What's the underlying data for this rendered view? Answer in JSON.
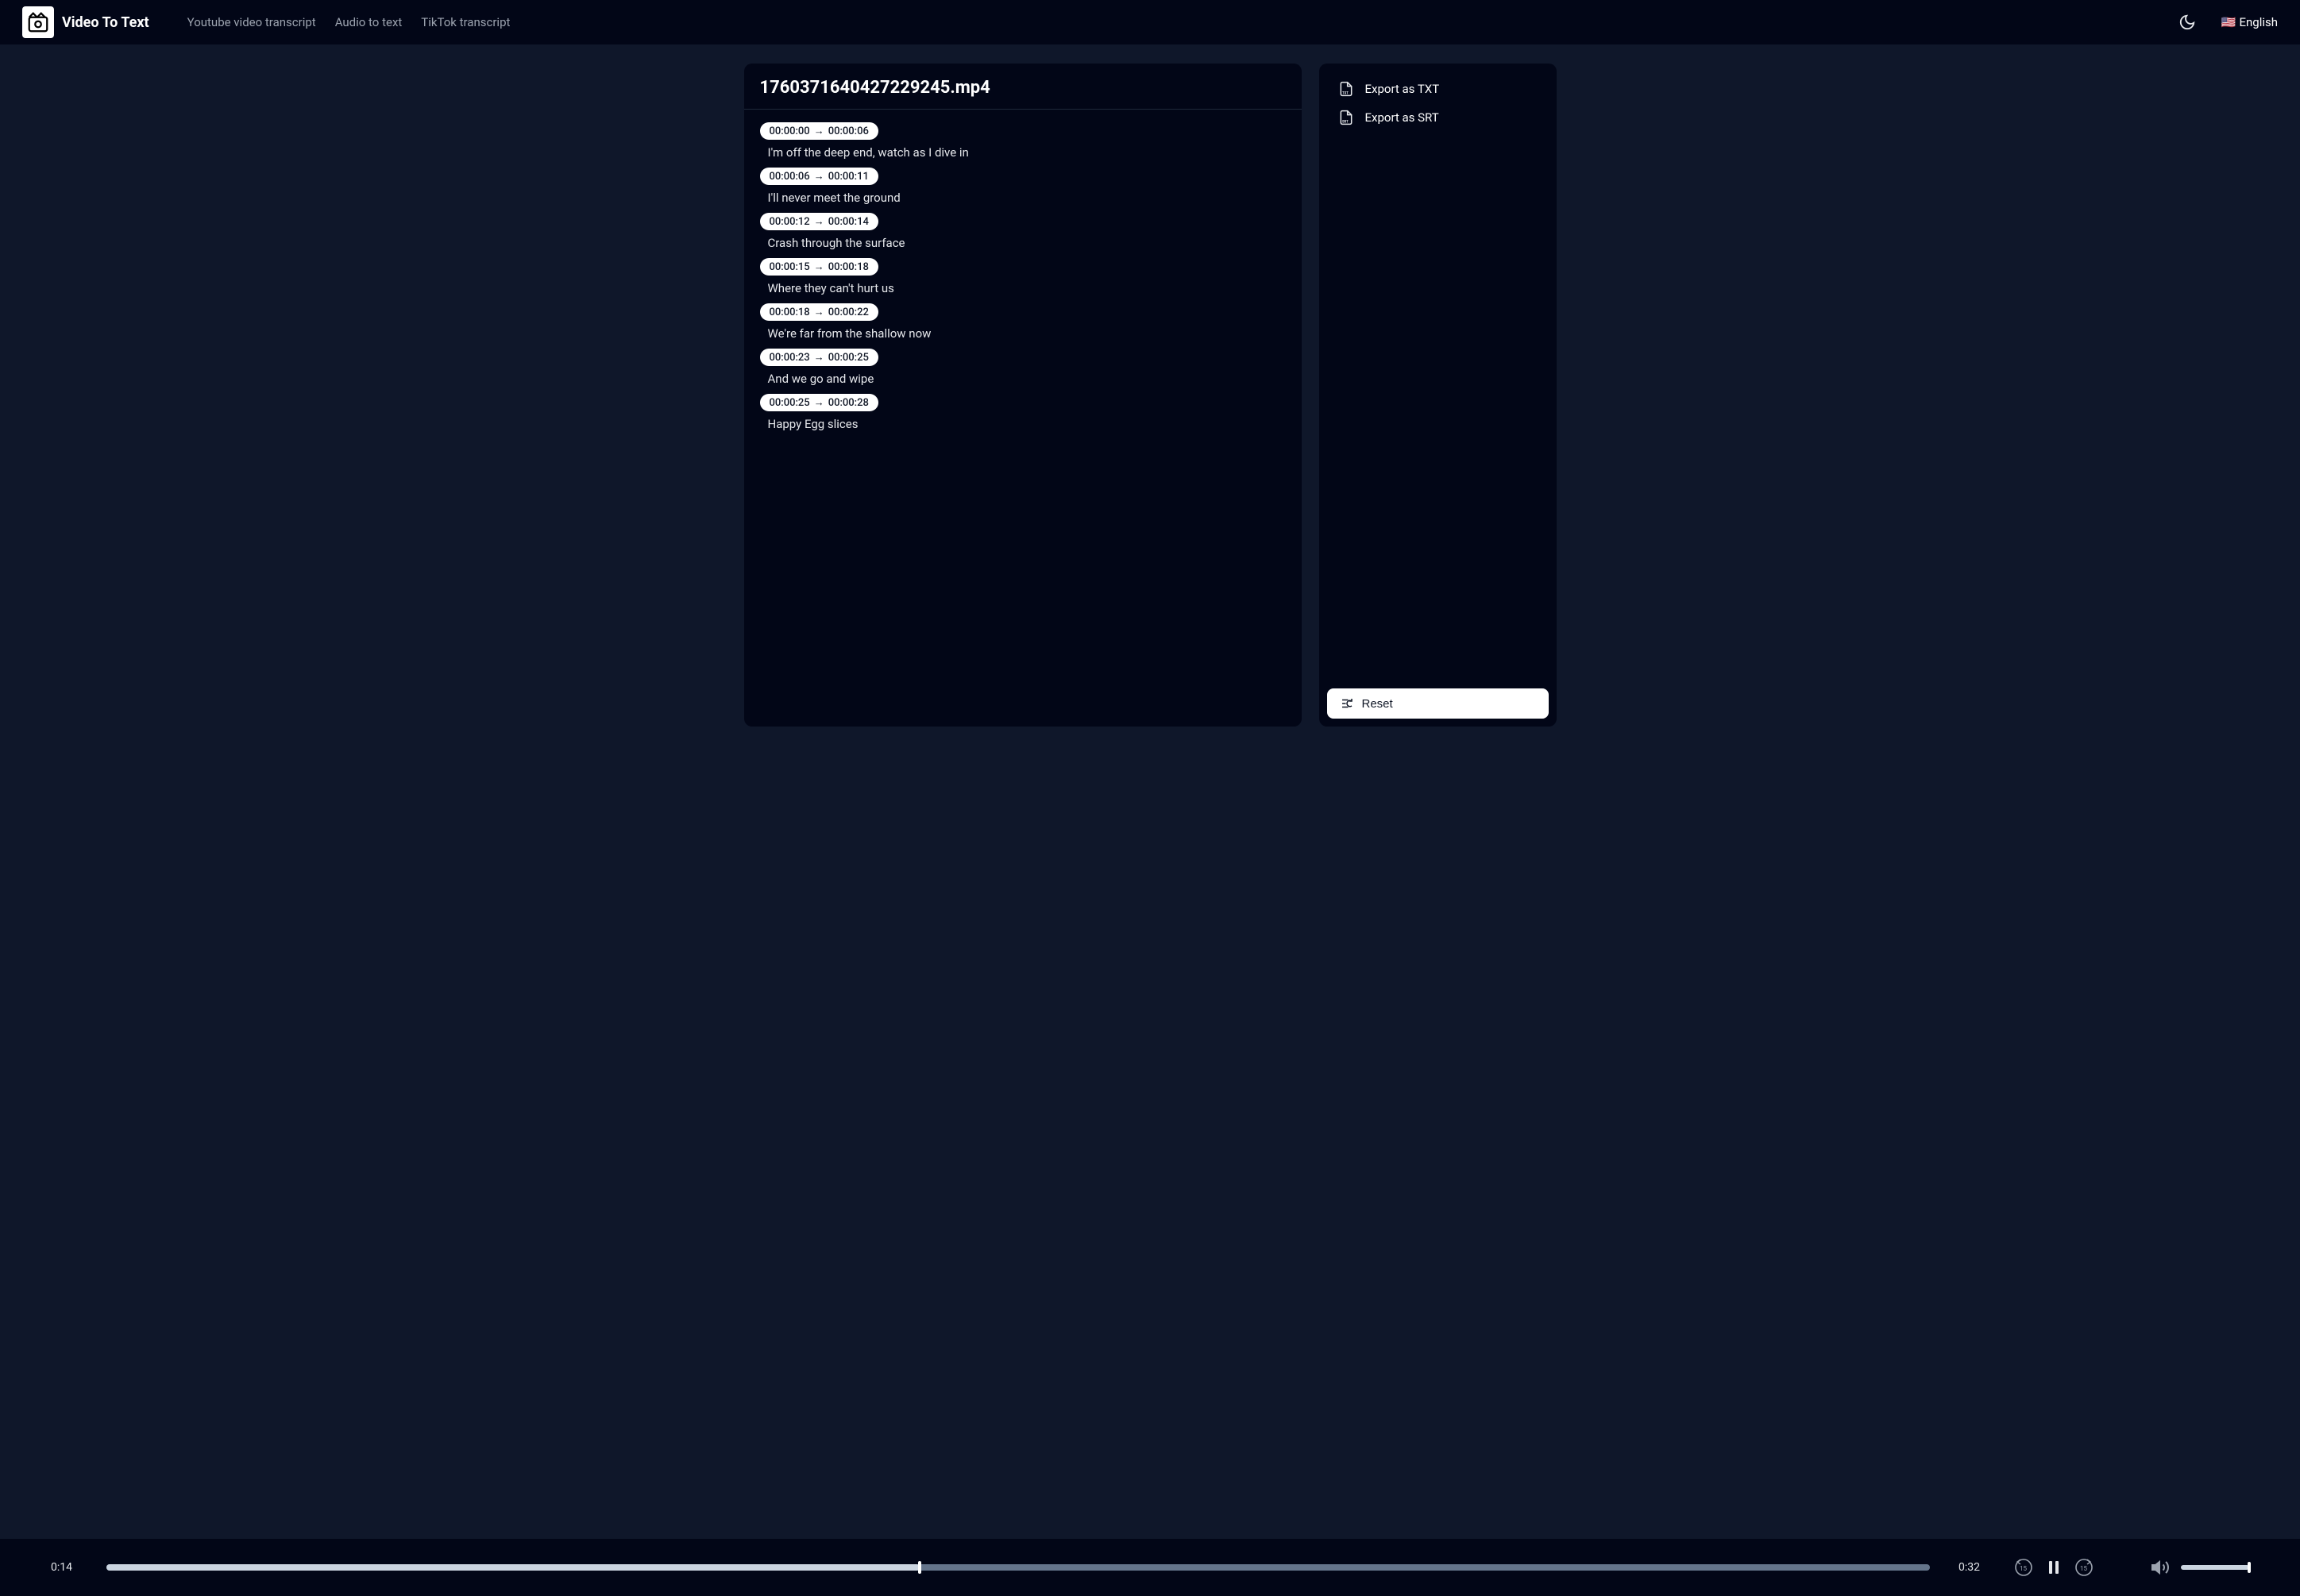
{
  "header": {
    "brand": "Video To Text",
    "nav": [
      "Youtube video transcript",
      "Audio to text",
      "TikTok transcript"
    ],
    "language_label": "English",
    "language_flag": "🇺🇸"
  },
  "main": {
    "filename": "1760371640427229245.mp4",
    "segments": [
      {
        "start": "00:00:00",
        "end": "00:00:06",
        "text": "I'm off the deep end, watch as I dive in"
      },
      {
        "start": "00:00:06",
        "end": "00:00:11",
        "text": "I'll never meet the ground"
      },
      {
        "start": "00:00:12",
        "end": "00:00:14",
        "text": "Crash through the surface"
      },
      {
        "start": "00:00:15",
        "end": "00:00:18",
        "text": "Where they can't hurt us"
      },
      {
        "start": "00:00:18",
        "end": "00:00:22",
        "text": "We're far from the shallow now"
      },
      {
        "start": "00:00:23",
        "end": "00:00:25",
        "text": "And we go and wipe"
      },
      {
        "start": "00:00:25",
        "end": "00:00:28",
        "text": "Happy Egg slices"
      }
    ]
  },
  "side": {
    "export_txt": "Export as TXT",
    "export_srt": "Export as SRT",
    "reset": "Reset"
  },
  "player": {
    "current": "0:14",
    "duration": "0:32"
  }
}
